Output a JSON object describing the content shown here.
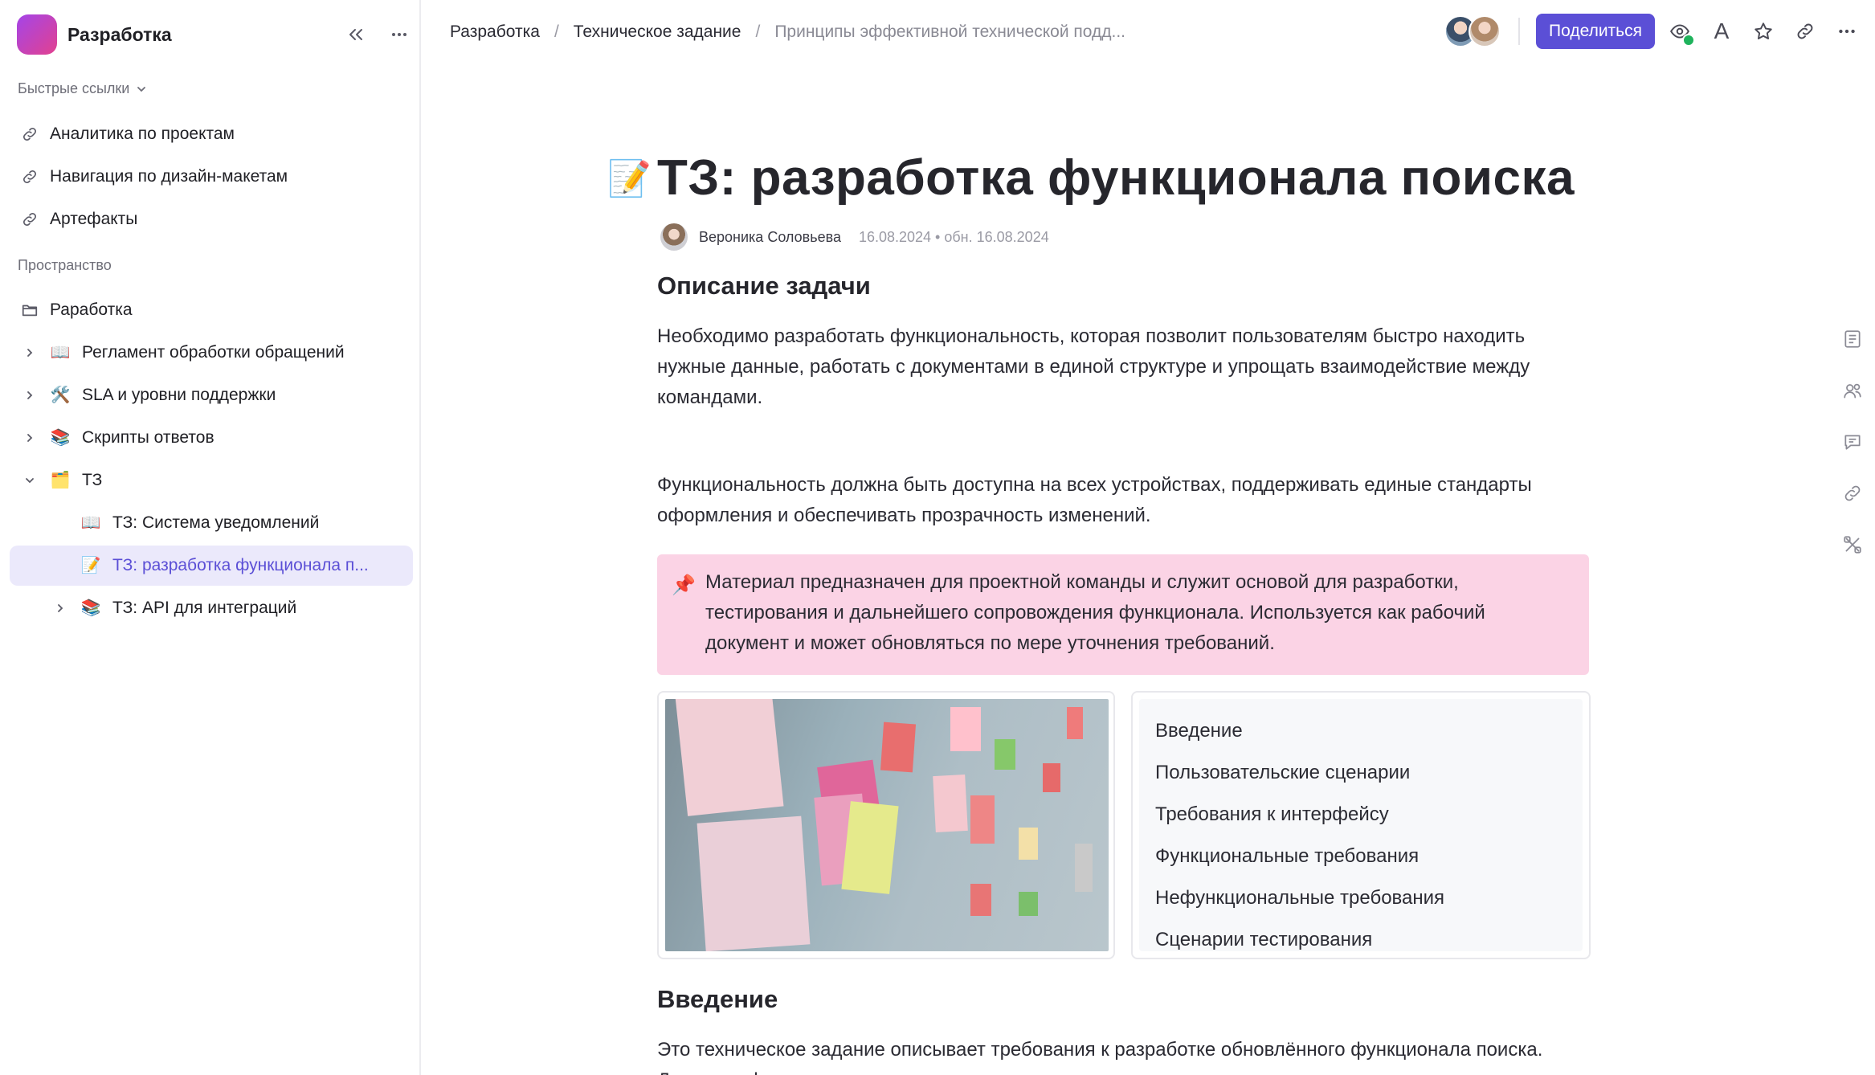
{
  "sidebar": {
    "workspace_name": "Разработка",
    "quick_links_label": "Быстрые ссылки",
    "quick_links": [
      {
        "label": "Аналитика по проектам",
        "icon": "link-icon"
      },
      {
        "label": "Навигация по дизайн-макетам",
        "icon": "link-icon"
      },
      {
        "label": "Артефакты",
        "icon": "link-icon"
      }
    ],
    "space_label": "Пространство",
    "space_root": {
      "label": "Раработка",
      "icon": "folder-icon"
    },
    "tree": [
      {
        "label": "Регламент обработки обращений",
        "emoji": "📖",
        "chevron": "right"
      },
      {
        "label": "SLA и уровни поддержки",
        "emoji": "🛠️",
        "chevron": "right"
      },
      {
        "label": "Скрипты ответов",
        "emoji": "📚",
        "chevron": "right"
      },
      {
        "label": "ТЗ",
        "emoji": "🗂️",
        "chevron": "down"
      },
      {
        "label": "ТЗ: Система уведомлений",
        "emoji": "📖",
        "chevron": "none"
      },
      {
        "label": "ТЗ: разработка функционала п...",
        "emoji": "📝",
        "chevron": "none",
        "active": true
      },
      {
        "label": "ТЗ: API для интеграций",
        "emoji": "📚",
        "chevron": "right"
      }
    ]
  },
  "topbar": {
    "breadcrumb": [
      "Разработка",
      "Техническое задание",
      "Принципы эффективной технической подд..."
    ],
    "share_label": "Поделиться",
    "font_label": "A"
  },
  "document": {
    "emoji": "📝",
    "title": "ТЗ: разработка функционала поиска",
    "author": "Вероника Соловьева",
    "dates": "16.08.2024 • обн. 16.08.2024",
    "section1_heading": "Описание задачи",
    "para1": "Необходимо разработать функциональность, которая позволит пользователям быстро находить нужные данные, работать с документами в единой структуре и упрощать взаимодействие между командами.",
    "para2": "Функциональность должна быть доступна на всех устройствах, поддерживать единые стандарты оформления и обеспечивать прозрачность изменений.",
    "callout_emoji": "📌",
    "callout": "Материал предназначен для проектной команды и служит основой для разработки, тестирования и дальнейшего сопровождения функционала. Используется как рабочий документ и может обновляться по мере уточнения требований.",
    "toc": [
      "Введение",
      "Пользовательские сценарии",
      "Требования к интерфейсу",
      "Функциональные требования",
      "Нефункциональные требования",
      "Сценарии тестирования"
    ],
    "section2_heading": "Введение",
    "para3": "Это техническое задание описывает требования к разработке обновлённого функционала поиска. Документ фиксирует цели, ключевые сценарии и ожидаемое поведение системы."
  },
  "colors": {
    "accent": "#5b4fd6",
    "active_bg": "#ebe9fb",
    "callout_bg": "#fbd3e5",
    "online": "#1fb35c"
  }
}
